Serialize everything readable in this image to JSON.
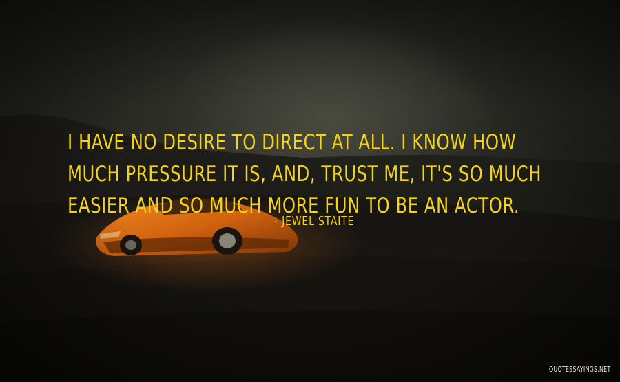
{
  "quote": {
    "lines": [
      "I have no desire to direct at all. I know how",
      "much pressure it is, and, trust me, it's so much",
      "easier and so much more fun to be an actor."
    ],
    "author": "- Jewel Staite"
  },
  "watermark": "QUOTESSAYINGS.NET",
  "colors": {
    "text": "#f2d21a",
    "background": "#1a1a17",
    "car": "#d86a14"
  }
}
